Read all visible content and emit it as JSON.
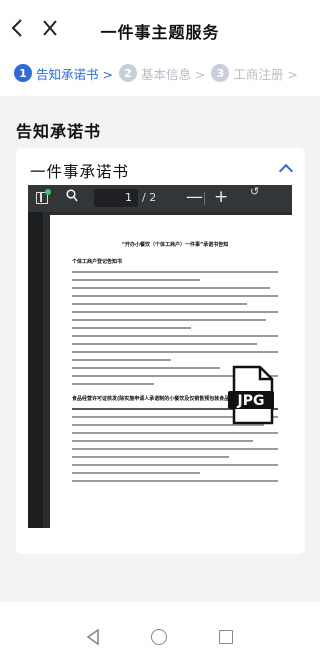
{
  "header": {
    "back_icon": "chevron-left-icon",
    "close_icon": "close-icon",
    "title": "一件事主题服务"
  },
  "steps": [
    {
      "num": "1",
      "label": "告知承诺书 >",
      "state": "active"
    },
    {
      "num": "2",
      "label": "基本信息 >",
      "state": "inactive"
    },
    {
      "num": "3",
      "label": "工商注册 >",
      "state": "inactive"
    }
  ],
  "section": {
    "title": "告知承诺书"
  },
  "card": {
    "title": "一件事承诺书",
    "expanded": true
  },
  "viewer": {
    "current_page": "1",
    "total_pages": "/ 2",
    "zoom_out": "—",
    "zoom_in": "+",
    "rotate": "↺",
    "doc_heading": "“开办小餐饮（个体工商户）一件事”承诺书告知",
    "sub_heading_1": "个体工商户登记告知书",
    "sub_heading_2": "食品经营许可证核发(除实施申请人承诺制的小餐饮及仅销售预包装食品之外的食品经营者)：",
    "overlay_icon": "jpg-file-icon",
    "overlay_label": "JPG"
  },
  "colors": {
    "accent": "#2f6bd8",
    "inactive_step": "#c9cfda",
    "background": "#f2f3f5"
  }
}
